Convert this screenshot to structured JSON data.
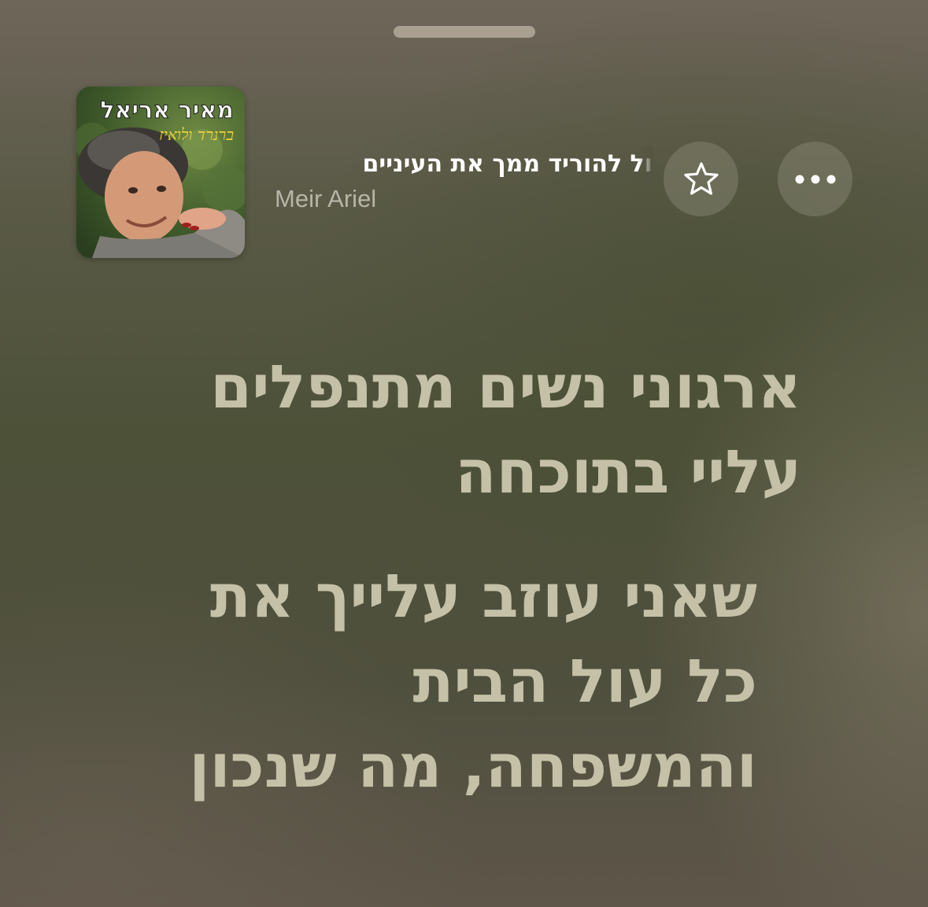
{
  "now_playing": {
    "title": "ול להוריד ממך את העיניים",
    "artist": "Meir Ariel",
    "artwork": {
      "artist_text": "מאיר אריאל",
      "album_text": "ברנרד ולואיז"
    }
  },
  "controls": {
    "favorite_icon": "star-outline-icon",
    "more_icon": "ellipsis-icon"
  },
  "lyrics": {
    "stanzas": [
      {
        "lines": [
          "ארגוני נשים מתנפלים",
          "עליי בתוכחה"
        ]
      },
      {
        "lines": [
          "שאני עוזב עלייך את",
          "כל עול הבית",
          "והמשפחה, מה שנכון"
        ]
      }
    ]
  },
  "colors": {
    "lyrics": "#c4c1a8",
    "title": "#ffffff",
    "artist": "#c8c6b9",
    "button_fill": "#82826e"
  }
}
